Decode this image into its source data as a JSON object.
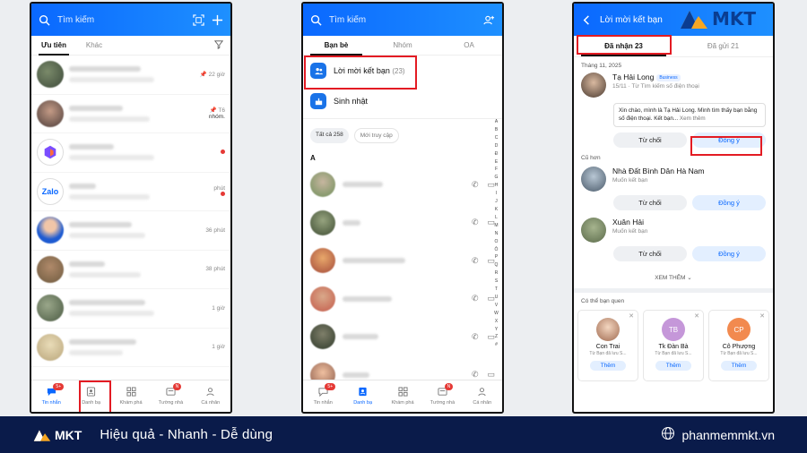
{
  "phone1": {
    "search_placeholder": "Tìm kiếm",
    "tabs": [
      "Ưu tiên",
      "Khác"
    ],
    "chats": [
      {
        "time": "22 giờ",
        "pinned": true
      },
      {
        "time": "T6",
        "pinned": true,
        "snippet": "nhóm."
      },
      {
        "time": "",
        "dot": true
      },
      {
        "time": "phút",
        "dot": true
      },
      {
        "time": "36 phút"
      },
      {
        "time": "38 phút"
      },
      {
        "time": "1 giờ"
      },
      {
        "time": "1 giờ"
      }
    ],
    "nav": [
      {
        "label": "Tin nhắn",
        "badge": "5+"
      },
      {
        "label": "Danh bạ"
      },
      {
        "label": "Khám phá"
      },
      {
        "label": "Tường nhà",
        "badge": "N"
      },
      {
        "label": "Cá nhân"
      }
    ]
  },
  "phone2": {
    "search_placeholder": "Tìm kiếm",
    "tabs": [
      "Bạn bè",
      "Nhóm",
      "OA"
    ],
    "friend_requests_label": "Lời mời kết bạn",
    "friend_requests_count": "(23)",
    "birthday_label": "Sinh nhật",
    "chip_all": "Tất cả",
    "chip_all_count": "258",
    "chip_recent": "Mới truy cập",
    "section_letter": "A",
    "alphabet": [
      "A",
      "B",
      "C",
      "D",
      "Đ",
      "E",
      "F",
      "G",
      "H",
      "I",
      "J",
      "K",
      "L",
      "M",
      "N",
      "O",
      "Ô",
      "P",
      "Q",
      "R",
      "S",
      "T",
      "U",
      "V",
      "W",
      "X",
      "Y",
      "Z",
      "#"
    ],
    "nav": [
      {
        "label": "Tin nhắn",
        "badge": "5+"
      },
      {
        "label": "Danh bạ"
      },
      {
        "label": "Khám phá"
      },
      {
        "label": "Tường nhà",
        "badge": "N"
      },
      {
        "label": "Cá nhân"
      }
    ]
  },
  "phone3": {
    "title": "Lời mời kết bạn",
    "tab_received": "Đã nhận",
    "tab_received_count": "23",
    "tab_sent": "Đã gửi",
    "tab_sent_count": "21",
    "month_label": "Tháng 11, 2025",
    "featured": {
      "name": "Tạ Hải Long",
      "business_badge": "Business",
      "sub": "15/11 · Từ Tìm kiếm số điện thoại",
      "message": "Xin chào, mình là Tạ Hải Long. Mình tìm thấy bạn bằng số điện thoại. Kết bạn...",
      "see_more": "Xem thêm"
    },
    "older_label": "Cũ hơn",
    "requests": [
      {
        "name": "Nhà Đất Bình Dân Hà Nam",
        "sub": "Muốn kết bạn"
      },
      {
        "name": "Xuân Hải",
        "sub": "Muốn kết bạn"
      }
    ],
    "reject_label": "Từ chối",
    "accept_label": "Đồng ý",
    "see_more_label": "XEM THÊM",
    "suggest_label": "Có thể bạn quen",
    "suggestions": [
      {
        "name": "Con Trai",
        "sub": "Từ Bạn đã lưu S...",
        "initials": "",
        "color": "#e8b7a0"
      },
      {
        "name": "Tk Đàn Bà",
        "sub": "Từ Bạn đã lưu S...",
        "initials": "TB",
        "color": "#c597d9"
      },
      {
        "name": "Cô Phượng",
        "sub": "Từ Bạn đã lưu S...",
        "initials": "CP",
        "color": "#f28a4f"
      }
    ],
    "add_label": "Thêm"
  },
  "brand": {
    "logo_text": "MKT",
    "slogan": "Hiệu quả - Nhanh - Dễ dùng",
    "website": "phanmemmkt.vn"
  },
  "colors": {
    "primary": "#0a68ff",
    "highlight": "#e31b23",
    "footer": "#0a1b4a"
  }
}
